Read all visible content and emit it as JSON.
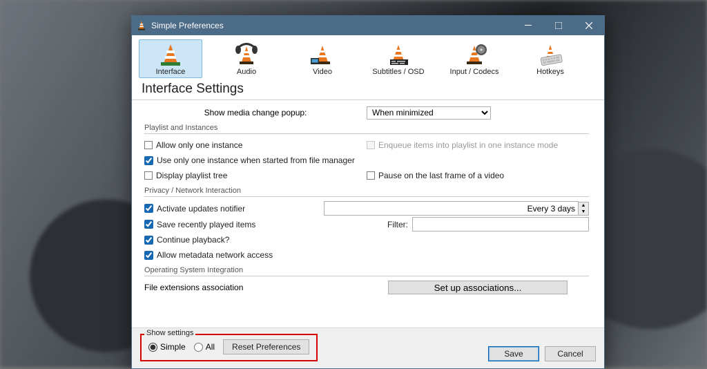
{
  "window": {
    "title": "Simple Preferences"
  },
  "categories": {
    "interface": "Interface",
    "audio": "Audio",
    "video": "Video",
    "subs": "Subtitles / OSD",
    "input": "Input / Codecs",
    "hotkeys": "Hotkeys"
  },
  "heading": "Interface Settings",
  "popup": {
    "label": "Show media change popup:",
    "value": "When minimized"
  },
  "playlist": {
    "group": "Playlist and Instances",
    "one_instance": "Allow only one instance",
    "one_instance_fm": "Use only one instance when started from file manager",
    "display_tree": "Display playlist tree",
    "enqueue": "Enqueue items into playlist in one instance mode",
    "pause_last": "Pause on the last frame of a video"
  },
  "privacy": {
    "group": "Privacy / Network Interaction",
    "updates": "Activate updates notifier",
    "updates_interval": "Every 3 days",
    "recent": "Save recently played items",
    "filter_label": "Filter:",
    "continue": "Continue playback?",
    "metadata": "Allow metadata network access"
  },
  "os": {
    "group": "Operating System Integration",
    "assoc_label": "File extensions association",
    "assoc_btn": "Set up associations..."
  },
  "footer": {
    "show_settings": "Show settings",
    "simple": "Simple",
    "all": "All",
    "reset": "Reset Preferences",
    "save": "Save",
    "cancel": "Cancel"
  }
}
